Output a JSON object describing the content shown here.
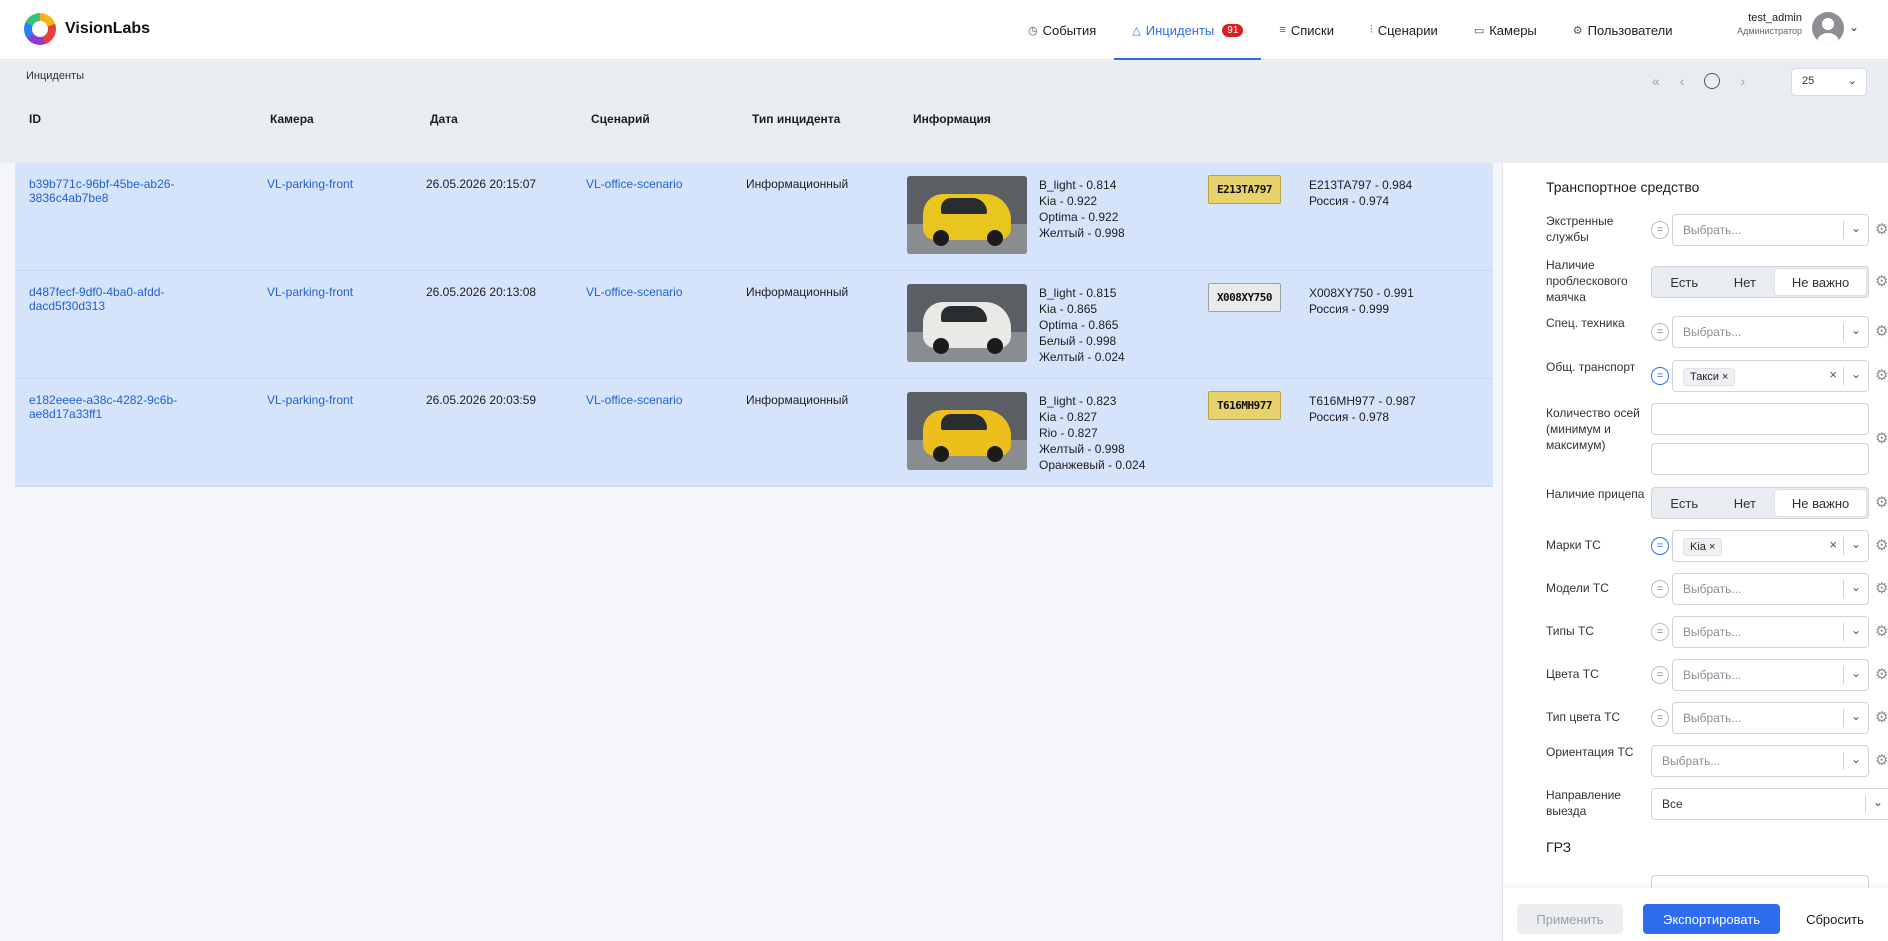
{
  "app": {
    "brand": "VisionLabs"
  },
  "nav": [
    {
      "icon": "clock-icon",
      "glyph": "◷",
      "label": "События",
      "active": false
    },
    {
      "icon": "warning-icon",
      "glyph": "△",
      "label": "Инциденты",
      "active": true,
      "badge": "91"
    },
    {
      "icon": "list-icon",
      "glyph": "≡",
      "label": "Списки",
      "active": false
    },
    {
      "icon": "scenario-icon",
      "glyph": "⫶",
      "label": "Сценарии",
      "active": false
    },
    {
      "icon": "camera-icon",
      "glyph": "▭",
      "label": "Камеры",
      "active": false
    },
    {
      "icon": "users-icon",
      "glyph": "⚙",
      "label": "Пользователи",
      "active": false
    }
  ],
  "user": {
    "name": "test_admin",
    "role": "Администратор"
  },
  "breadcrumb": "Инциденты",
  "pagination": {
    "page_size": "25"
  },
  "table": {
    "columns": [
      "ID",
      "Камера",
      "Дата",
      "Сценарий",
      "Тип инцидента",
      "Информация"
    ],
    "rows": [
      {
        "id_line1": "b39b771c-96bf-45be-ab26-",
        "id_line2": "3836c4ab7be8",
        "camera": "VL-parking-front",
        "date": "26.05.2026 20:15:07",
        "scenario": "VL-office-scenario",
        "type": "Информационный",
        "car_color": "#e8c51f",
        "attrs": [
          "B_light - 0.814",
          "Kia - 0.922",
          "Optima - 0.922",
          "Желтый - 0.998"
        ],
        "plate_text": "E213TA797",
        "plate_style": "yellow",
        "lp": [
          "E213TA797 - 0.984",
          "Россия - 0.974"
        ]
      },
      {
        "id_line1": "d487fecf-9df0-4ba0-afdd-",
        "id_line2": "dacd5f30d313",
        "camera": "VL-parking-front",
        "date": "26.05.2026 20:13:08",
        "scenario": "VL-office-scenario",
        "type": "Информационный",
        "car_color": "#e9e9e6",
        "attrs": [
          "B_light - 0.815",
          "Kia - 0.865",
          "Optima - 0.865",
          "Белый - 0.998",
          "Желтый - 0.024"
        ],
        "plate_text": "X008XY750",
        "plate_style": "white",
        "lp": [
          "X008XY750 - 0.991",
          "Россия - 0.999"
        ]
      },
      {
        "id_line1": "e182eeee-a38c-4282-9c6b-",
        "id_line2": "ae8d17a33ff1",
        "camera": "VL-parking-front",
        "date": "26.05.2026 20:03:59",
        "scenario": "VL-office-scenario",
        "type": "Информационный",
        "car_color": "#ecbf1c",
        "attrs": [
          "B_light - 0.823",
          "Kia - 0.827",
          "Rio - 0.827",
          "Желтый - 0.998",
          "Оранжевый - 0.024"
        ],
        "plate_text": "T616MH977",
        "plate_style": "yellow",
        "lp": [
          "T616MH977 - 0.987",
          "Россия - 0.978"
        ]
      }
    ]
  },
  "filters": {
    "title": "Транспортное средство",
    "emergency": {
      "label": "Экстренные службы",
      "placeholder": "Выбрать..."
    },
    "beacon": {
      "label": "Наличие проблескового маячка",
      "options": [
        "Есть",
        "Нет",
        "Не важно"
      ],
      "selected": "Не важно"
    },
    "special": {
      "label": "Спец. техника",
      "placeholder": "Выбрать..."
    },
    "public": {
      "label": "Общ. транспорт",
      "chip": "Такси"
    },
    "axles": {
      "label": "Количество осей (минимум и максимум)"
    },
    "trailer": {
      "label": "Наличие прицепа",
      "options": [
        "Есть",
        "Нет",
        "Не важно"
      ],
      "selected": "Не важно"
    },
    "brands": {
      "label": "Марки ТС",
      "chip": "Kia"
    },
    "models": {
      "label": "Модели ТС",
      "placeholder": "Выбрать..."
    },
    "types": {
      "label": "Типы ТС",
      "placeholder": "Выбрать..."
    },
    "colors": {
      "label": "Цвета ТС",
      "placeholder": "Выбрать..."
    },
    "color_type": {
      "label": "Тип цвета ТС",
      "placeholder": "Выбрать..."
    },
    "orientation": {
      "label": "Ориентация ТС",
      "placeholder": "Выбрать..."
    },
    "direction": {
      "label": "Направление выезда",
      "value": "Все"
    },
    "plate_section": "ГРЗ"
  },
  "actions": {
    "apply": "Применить",
    "export": "Экспортировать",
    "reset": "Сбросить"
  },
  "colors": {
    "accent": "#2f6df0",
    "row_bg": "#d6e4fb",
    "badge": "#d81e1e"
  }
}
